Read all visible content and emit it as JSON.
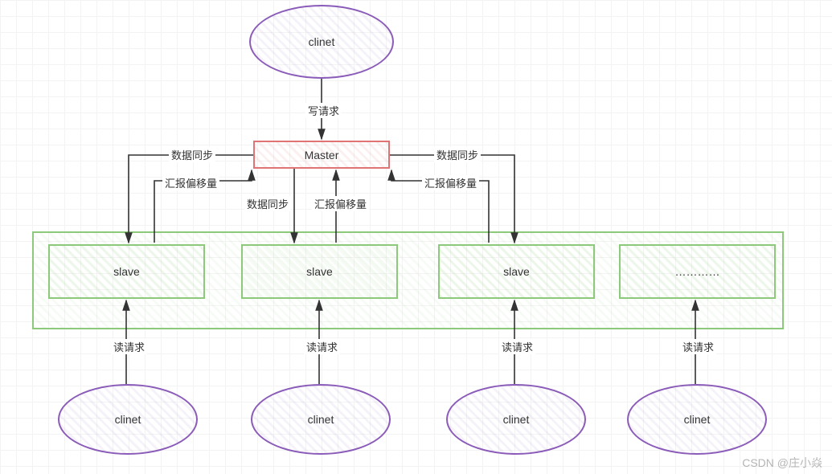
{
  "diagram": {
    "client_top": "clinet",
    "master": "Master",
    "slaves": [
      "slave",
      "slave",
      "slave",
      "…………"
    ],
    "clients_bottom": [
      "clinet",
      "clinet",
      "clinet",
      "clinet"
    ],
    "labels": {
      "write_request": "写请求",
      "data_sync": "数据同步",
      "report_offset": "汇报偏移量",
      "read_request": "读请求"
    }
  },
  "watermark": "CSDN @庄小焱"
}
